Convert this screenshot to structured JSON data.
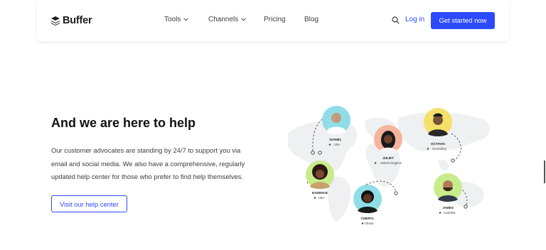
{
  "header": {
    "logo_text": "Buffer",
    "nav": [
      {
        "label": "Tools",
        "has_dropdown": true
      },
      {
        "label": "Channels",
        "has_dropdown": true
      },
      {
        "label": "Pricing",
        "has_dropdown": false
      },
      {
        "label": "Blog",
        "has_dropdown": false
      }
    ],
    "login_label": "Log in",
    "cta_label": "Get started now"
  },
  "main": {
    "heading": "And we are here to help",
    "paragraph_lines": [
      "Our customer advocates are standing by 24/7 to support you via",
      "email and social media. We also have a comprehensive, regularly",
      "updated help center for those who prefer to find help themselves."
    ],
    "help_button_label": "Visit our help center"
  },
  "advocates": [
    {
      "name": "DANIEL",
      "location": "USA",
      "ring_color": "#8fdde6"
    },
    {
      "name": "JULIET",
      "location": "United Kingdom",
      "ring_color": "#f5b39b"
    },
    {
      "name": "OCTAVIO",
      "location": "Nomading",
      "ring_color": "#f5e06a"
    },
    {
      "name": "ESSENCE",
      "location": "USA",
      "ring_color": "#c8ec8b"
    },
    {
      "name": "CHERYL",
      "location": "Ghana",
      "ring_color": "#8fdde6"
    },
    {
      "name": "JAMES",
      "location": "Australia",
      "ring_color": "#c8ec8b"
    }
  ],
  "colors": {
    "accent": "#2c4bff",
    "text": "#1c1c1c"
  }
}
